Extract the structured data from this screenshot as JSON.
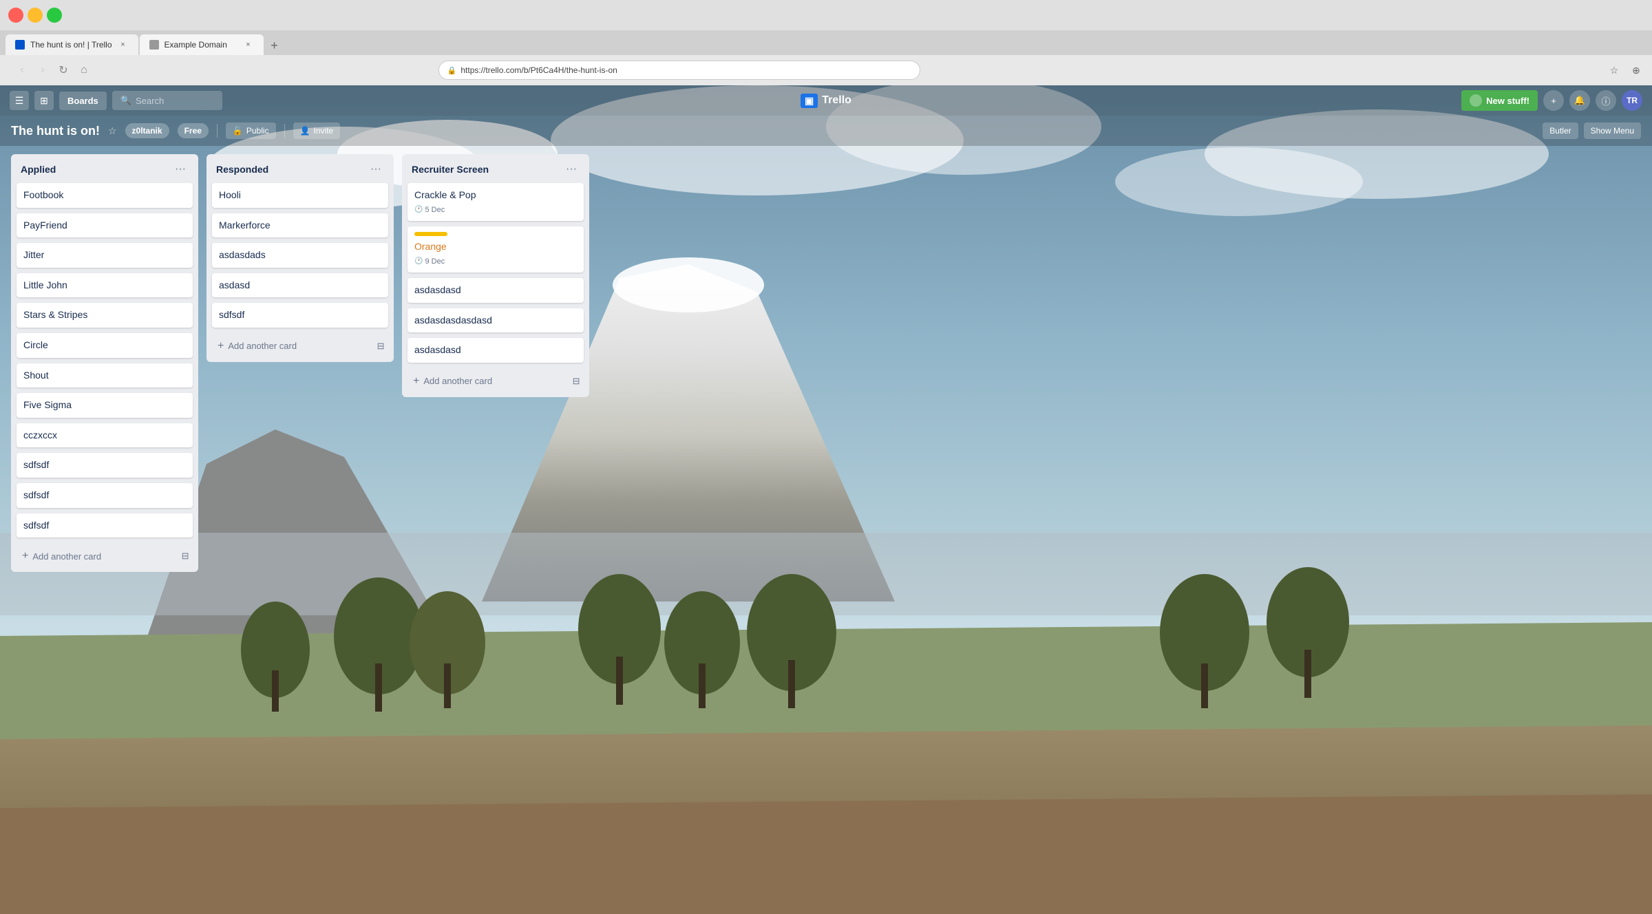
{
  "browser": {
    "tabs": [
      {
        "label": "The hunt is on! | Trello",
        "active": true,
        "favicon": "trello"
      },
      {
        "label": "Example Domain",
        "active": false,
        "favicon": "example"
      }
    ],
    "address": "https://trello.com/b/Pt6Ca4H/the-hunt-is-on",
    "back_btn": "‹",
    "forward_btn": "›",
    "refresh_btn": "↻"
  },
  "trello": {
    "nav": {
      "hamburger_label": "☰",
      "home_label": "⊞",
      "boards_label": "Boards",
      "search_placeholder": "🔍 Search",
      "logo": "Trello",
      "new_stuff_label": "New stuff!",
      "add_icon": "+",
      "notification_icon": "🔔",
      "info_icon": "ⓘ"
    },
    "board": {
      "title": "The hunt is on!",
      "member": "z0ltanik",
      "free_badge": "Free",
      "visibility": "Public",
      "invite_label": "Invite",
      "butler_label": "Butler",
      "show_menu_label": "Show Menu",
      "plus_icon": "+",
      "avatar_initials": "TR"
    },
    "lists": [
      {
        "id": "applied",
        "title": "Applied",
        "cards": [
          {
            "text": "Footbook"
          },
          {
            "text": "PayFriend"
          },
          {
            "text": "Jitter"
          },
          {
            "text": "Little John"
          },
          {
            "text": "Stars & Stripes"
          },
          {
            "text": "Circle"
          },
          {
            "text": "Shout"
          },
          {
            "text": "Five Sigma"
          },
          {
            "text": "cczxccx"
          },
          {
            "text": "sdfsdf"
          },
          {
            "text": "sdfsdf"
          },
          {
            "text": "sdfsdf"
          }
        ],
        "add_card_label": "Add another card"
      },
      {
        "id": "responded",
        "title": "Responded",
        "cards": [
          {
            "text": "Hooli"
          },
          {
            "text": "Markerforce"
          },
          {
            "text": "asdasdads"
          },
          {
            "text": "asdasd"
          },
          {
            "text": "sdfsdf"
          }
        ],
        "add_card_label": "Add another card"
      },
      {
        "id": "recruiter-screen",
        "title": "Recruiter Screen",
        "cards": [
          {
            "text": "Crackle & Pop",
            "date": "5 Dec",
            "has_label": false
          },
          {
            "text": "Orange",
            "date": "9 Dec",
            "has_label": true,
            "card_class": "orange-name"
          },
          {
            "text": "asdasdasd"
          },
          {
            "text": "asdasdasdasdasd"
          },
          {
            "text": "asdasdasd"
          }
        ],
        "add_card_label": "Add another card"
      }
    ]
  }
}
